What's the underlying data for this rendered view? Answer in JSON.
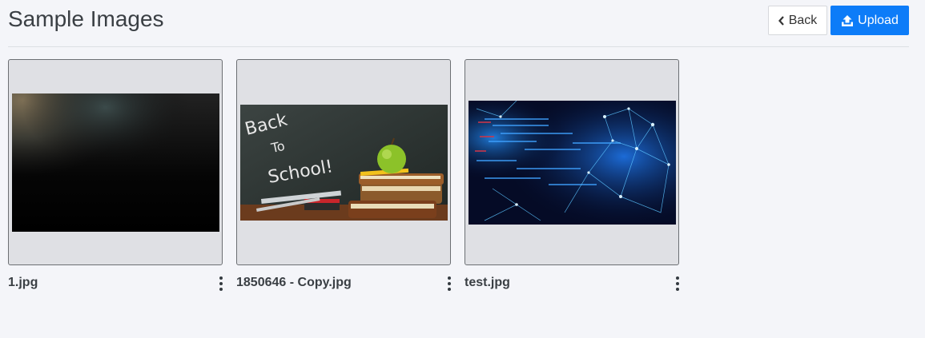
{
  "header": {
    "title": "Sample Images",
    "back_label": "Back",
    "upload_label": "Upload",
    "back_icon": "chevron-left-icon",
    "upload_icon": "upload-icon"
  },
  "colors": {
    "background": "#f4f5f9",
    "primary": "#0d7cf8",
    "card_bg": "#dfe0e4"
  },
  "images": [
    {
      "name": "1.jpg",
      "thumbnail": "dark-blurred-photo",
      "menu_icon": "kebab-menu-icon"
    },
    {
      "name": "1850646 - Copy.jpg",
      "thumbnail": "back-to-school-chalkboard-apple-books",
      "menu_icon": "kebab-menu-icon"
    },
    {
      "name": "test.jpg",
      "thumbnail": "blue-network-code-abstract",
      "menu_icon": "kebab-menu-icon"
    }
  ],
  "thumbnail_text": {
    "chalk_line1": "Back",
    "chalk_line2": "To",
    "chalk_line3": "School!"
  }
}
